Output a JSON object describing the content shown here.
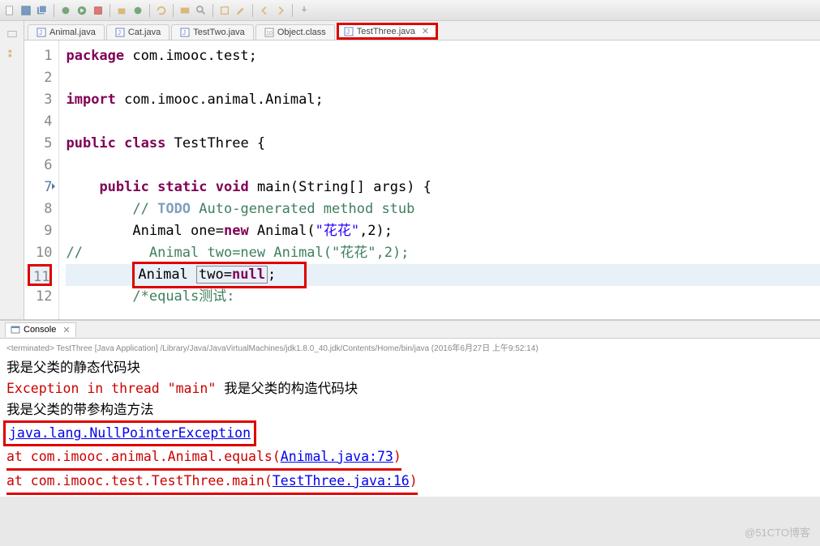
{
  "tabs": [
    {
      "label": "Animal.java"
    },
    {
      "label": "Cat.java"
    },
    {
      "label": "TestTwo.java"
    },
    {
      "label": "Object.class"
    },
    {
      "label": "TestThree.java",
      "active": true
    }
  ],
  "line_numbers": [
    "1",
    "2",
    "3",
    "4",
    "5",
    "6",
    "7",
    "8",
    "9",
    "10",
    "11",
    "12"
  ],
  "code": {
    "l1": {
      "kw": "package",
      "rest": " com.imooc.test;"
    },
    "l3": {
      "kw": "import",
      "rest": " com.imooc.animal.Animal;"
    },
    "l5_a": "public",
    "l5_b": "class",
    "l5_c": " TestThree {",
    "l7_a": "public",
    "l7_b": "static",
    "l7_c": "void",
    "l7_d": " main(String[] args) {",
    "l8_a": "// ",
    "l8_todo": "TODO",
    "l8_b": " Auto-generated method stub",
    "l9_a": "Animal one=",
    "l9_new": "new",
    "l9_b": " Animal(",
    "l9_str": "\"花花\"",
    "l9_c": ",2);",
    "l10_pre": "//        ",
    "l10_a": "Animal two=new Animal(\"花花\",2);",
    "l11_a": "Animal ",
    "l11_b": "two=",
    "l11_null": "null",
    "l11_c": ";",
    "l12": "/*equals测试:"
  },
  "console": {
    "tab_label": "Console",
    "status": "<terminated> TestThree [Java Application] /Library/Java/JavaVirtualMachines/jdk1.8.0_40.jdk/Contents/Home/bin/java (2016年6月27日 上午9:52:14)",
    "line1": "我是父类的静态代码块",
    "line2_a": "Exception in thread \"main\" ",
    "line2_b": "我是父类的构造代码块",
    "line3": "我是父类的带参构造方法",
    "line4": "java.lang.NullPointerException",
    "line5_a": "at com.imooc.animal.Animal.equals(",
    "line5_link": "Animal.java:73",
    "line5_b": ")",
    "line6_a": "at com.imooc.test.TestThree.main(",
    "line6_link": "TestThree.java:16",
    "line6_b": ")"
  },
  "watermark": "@51CTO博客"
}
